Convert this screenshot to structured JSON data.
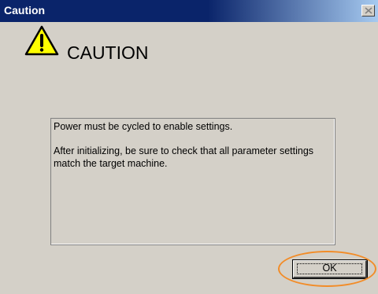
{
  "window": {
    "title": "Caution"
  },
  "icons": {
    "close": "close-icon",
    "caution": "warning-triangle-icon"
  },
  "heading": "CAUTION",
  "message": {
    "line1": "Power must be cycled to enable settings.",
    "line2": "After initializing, be sure to check that all parameter settings match the target machine."
  },
  "buttons": {
    "ok_label": "OK"
  },
  "colors": {
    "title_bar": "#0a246a",
    "dialog_face": "#d4d0c8",
    "warning_fill": "#ffff00",
    "highlight": "#f28c28"
  }
}
